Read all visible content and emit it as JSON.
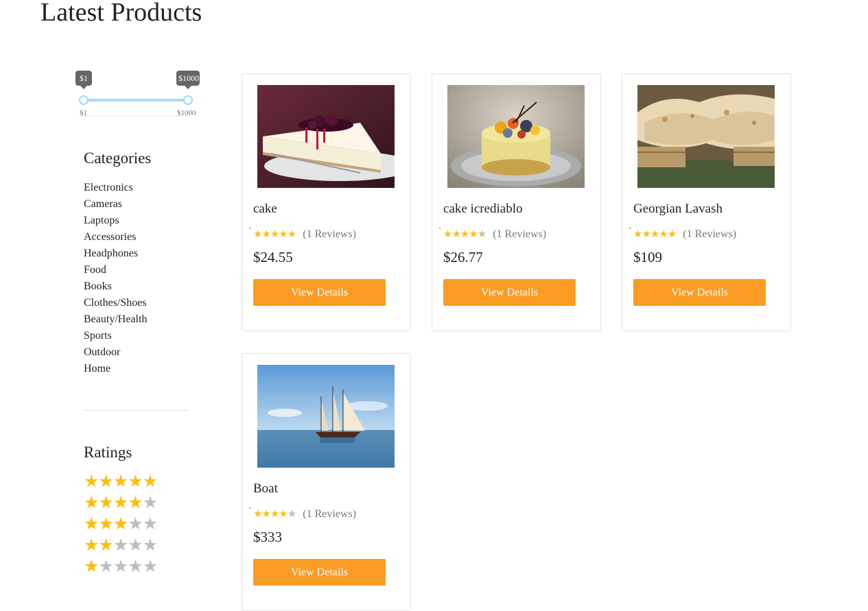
{
  "page": {
    "title": "Latest Products"
  },
  "price_filter": {
    "min": 1,
    "max": 1000,
    "min_label": "$1",
    "max_label": "$1000"
  },
  "sidebar": {
    "categories_title": "Categories",
    "categories": [
      "Electronics",
      "Cameras",
      "Laptops",
      "Accessories",
      "Headphones",
      "Food",
      "Books",
      "Clothes/Shoes",
      "Beauty/Health",
      "Sports",
      "Outdoor",
      "Home"
    ],
    "ratings_title": "Ratings",
    "ratings": [
      5,
      4,
      3,
      2,
      1
    ]
  },
  "products": [
    {
      "name": "cake",
      "rating": 5,
      "reviews_label": "(1 Reviews)",
      "price": "$24.55",
      "button_label": "View Details",
      "image_icon": "cheesecake-photo"
    },
    {
      "name": "cake icrediablo",
      "rating": 4.5,
      "reviews_label": "(1 Reviews)",
      "price": "$26.77",
      "button_label": "View Details",
      "image_icon": "fruit-cake-photo"
    },
    {
      "name": "Georgian Lavash",
      "rating": 5,
      "reviews_label": "(1 Reviews)",
      "price": "$109",
      "button_label": "View Details",
      "image_icon": "lavash-bread-photo"
    },
    {
      "name": "Boat",
      "rating": 4,
      "reviews_label": "(1 Reviews)",
      "price": "$333",
      "button_label": "View Details",
      "image_icon": "sailing-ship-photo"
    }
  ],
  "colors": {
    "accent": "#fa9c23",
    "star_on": "#febd0d",
    "star_off": "#bdbdbd",
    "slider": "#96dbfa"
  }
}
